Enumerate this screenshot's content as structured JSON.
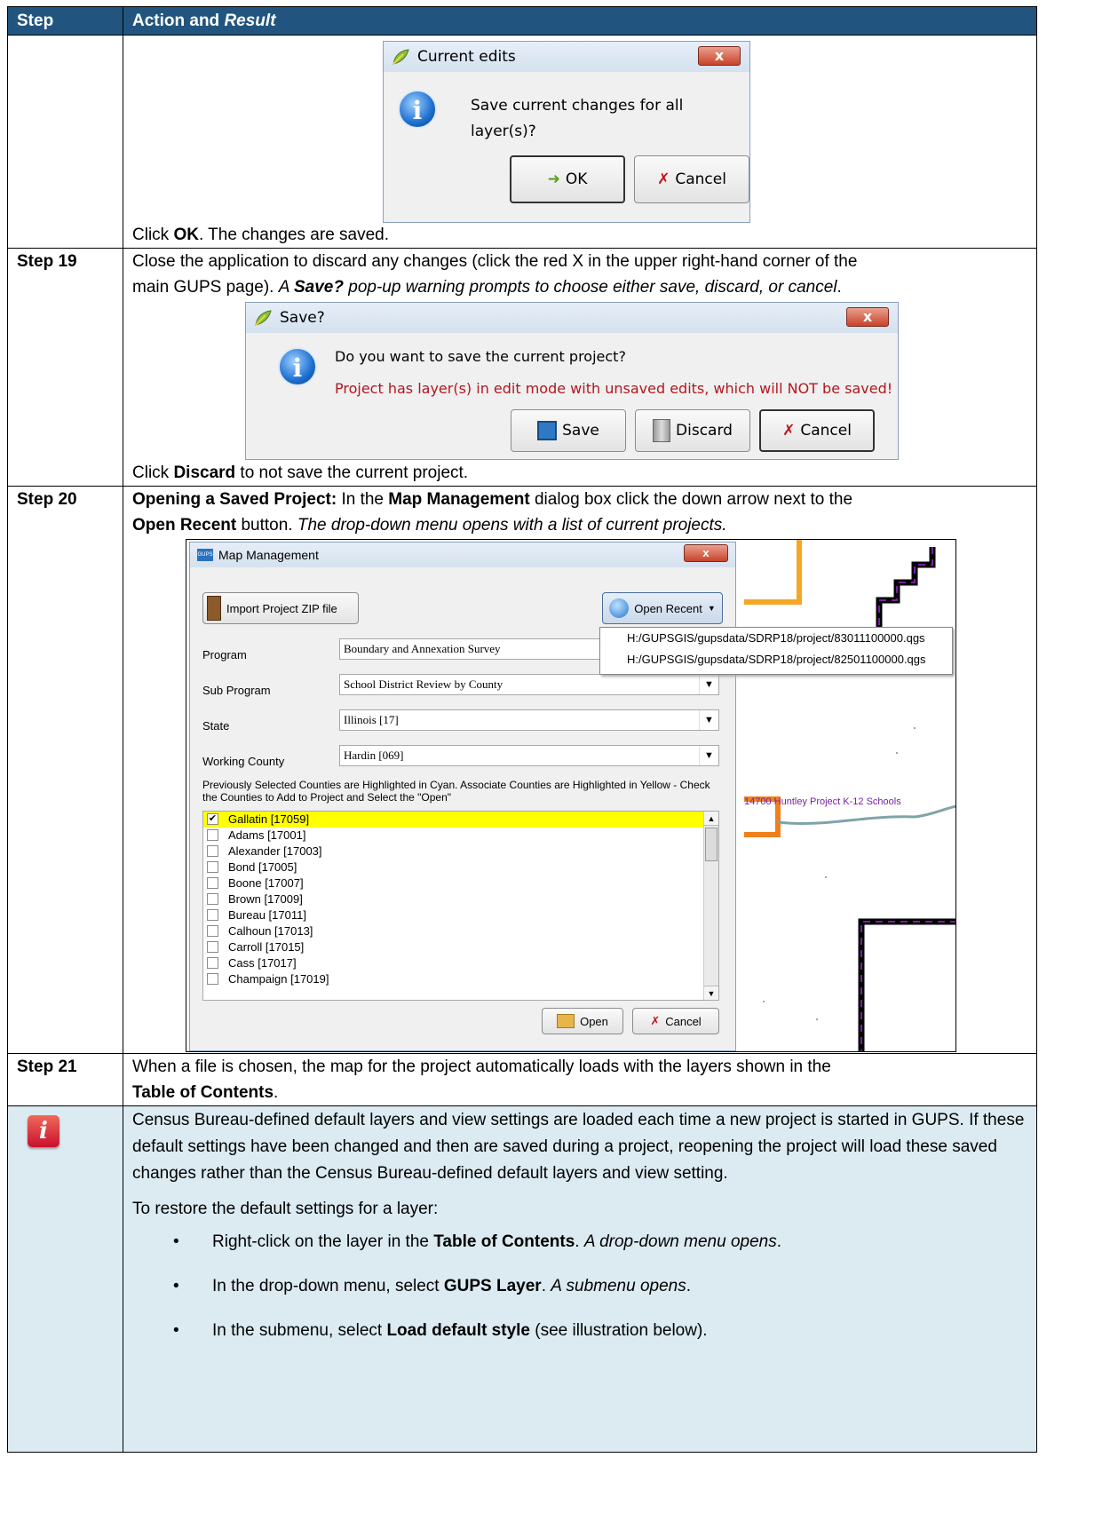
{
  "table": {
    "header": {
      "step": "Step",
      "action": "Action and ",
      "result": "Result"
    }
  },
  "rows": {
    "r18": {
      "text_pre": "Click ",
      "text_bold": "OK",
      "text_post": ". The changes are saved."
    },
    "r19": {
      "step": "Step 19",
      "line1": "Close the application to discard any changes (click the red X in the upper right-hand corner of the",
      "line2_pre": "main GUPS page). ",
      "line2_italic_pre": "A ",
      "line2_italic_bold": "Save?",
      "line2_italic_post": " pop-up warning prompts to choose either save, discard, or cancel",
      "line2_end": ".",
      "after_pre": "Click ",
      "after_bold": "Discard",
      "after_post": " to not save the current project."
    },
    "r20": {
      "step": "Step 20",
      "bold1": "Opening a Saved Project:",
      "t1": " In the ",
      "bold2": "Map Management",
      "t2": " dialog box click the down arrow next to the",
      "bold3": "Open Recent",
      "t3": " button. ",
      "italic": "The drop-down menu opens with a list of current projects."
    },
    "r21": {
      "step": "Step 21",
      "t1": "When a file is chosen, the map for the project automatically loads with the layers shown in the",
      "bold": "Table of Contents",
      "t2": "."
    }
  },
  "dialog_current_edits": {
    "title": "Current edits",
    "close": "x",
    "message": "Save current changes for all layer(s)?",
    "ok": "OK",
    "cancel": "Cancel"
  },
  "dialog_save": {
    "title": "Save?",
    "close": "x",
    "message": "Do you want to save the current project?",
    "warning": "Project has layer(s) in edit mode with unsaved edits, which will NOT be saved!",
    "save": "Save",
    "discard": "Discard",
    "cancel": "Cancel"
  },
  "map_management": {
    "title": "Map Management",
    "app_badge": "GUPS",
    "close": "x",
    "import_btn": "Import Project ZIP file",
    "open_recent": "Open Recent",
    "recent_items": [
      "H:/GUPSGIS/gupsdata/SDRP18/project/83011100000.qgs",
      "H:/GUPSGIS/gupsdata/SDRP18/project/82501100000.qgs"
    ],
    "fields": {
      "program_label": "Program",
      "program_value": "Boundary and Annexation Survey",
      "subprogram_label": "Sub Program",
      "subprogram_value": "School District Review by County",
      "state_label": "State",
      "state_value": "Illinois [17]",
      "county_label": "Working County",
      "county_value": "Hardin [069]"
    },
    "instructions": "Previously Selected Counties are Highlighted in Cyan. Associate Counties are Highlighted in Yellow - Check the Counties to Add to Project and Select the \"Open\"",
    "counties": [
      {
        "name": "Gallatin [17059]",
        "checked": true
      },
      {
        "name": "Adams [17001]",
        "checked": false
      },
      {
        "name": "Alexander [17003]",
        "checked": false
      },
      {
        "name": "Bond [17005]",
        "checked": false
      },
      {
        "name": "Boone [17007]",
        "checked": false
      },
      {
        "name": "Brown [17009]",
        "checked": false
      },
      {
        "name": "Bureau [17011]",
        "checked": false
      },
      {
        "name": "Calhoun [17013]",
        "checked": false
      },
      {
        "name": "Carroll [17015]",
        "checked": false
      },
      {
        "name": "Cass [17017]",
        "checked": false
      },
      {
        "name": "Champaign [17019]",
        "checked": false
      }
    ],
    "open_btn": "Open",
    "cancel_btn": "Cancel",
    "map_label": "14700 Huntley Project K-12 Schools"
  },
  "note": {
    "icon": "i",
    "para": "Census Bureau-defined default layers and view settings are loaded each time a new project is started in GUPS. If these default settings have been changed and then are saved during a project, reopening the project will load these saved changes rather than the Census Bureau-defined default layers and view setting.",
    "restore": "To restore the default settings for a layer:",
    "b1_pre": "Right-click on the layer in the ",
    "b1_bold": "Table of Contents",
    "b1_mid": ". ",
    "b1_italic": "A drop-down menu opens",
    "b1_end": ".",
    "b2_pre": "In the drop-down menu, select ",
    "b2_bold": "GUPS Layer",
    "b2_mid": ". ",
    "b2_italic": "A submenu opens",
    "b2_end": ".",
    "b3_pre": "In the submenu, select ",
    "b3_bold": "Load default style",
    "b3_end": " (see illustration below)."
  },
  "colors": {
    "header_bg": "#21557f",
    "note_bg": "#dcebf2",
    "highlight": "#ffff00",
    "warning": "#b1171f"
  }
}
